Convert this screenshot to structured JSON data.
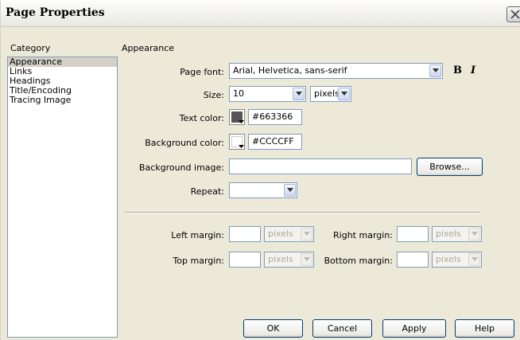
{
  "window": {
    "title": "Page Properties"
  },
  "category": {
    "header": "Category",
    "items": [
      "Appearance",
      "Links",
      "Headings",
      "Title/Encoding",
      "Tracing Image"
    ],
    "selected": "Appearance"
  },
  "panel": {
    "header": "Appearance",
    "page_font": {
      "label": "Page font:",
      "value": "Arial, Helvetica, sans-serif",
      "bold_label": "B",
      "italic_label": "I"
    },
    "size": {
      "label": "Size:",
      "value": "10",
      "unit": "pixels"
    },
    "text_color": {
      "label": "Text color:",
      "value": "#663366",
      "swatch": "#555555"
    },
    "background_color": {
      "label": "Background color:",
      "value": "#CCCCFF"
    },
    "background_image": {
      "label": "Background image:",
      "value": "",
      "browse_label": "Browse..."
    },
    "repeat": {
      "label": "Repeat:",
      "value": ""
    },
    "margins": {
      "left": {
        "label": "Left margin:",
        "unit": "pixels"
      },
      "right": {
        "label": "Right margin:",
        "unit": "pixels"
      },
      "top": {
        "label": "Top margin:",
        "unit": "pixels"
      },
      "bottom": {
        "label": "Bottom margin:",
        "unit": "pixels"
      }
    }
  },
  "buttons": {
    "ok": "OK",
    "cancel": "Cancel",
    "apply": "Apply",
    "help": "Help"
  }
}
